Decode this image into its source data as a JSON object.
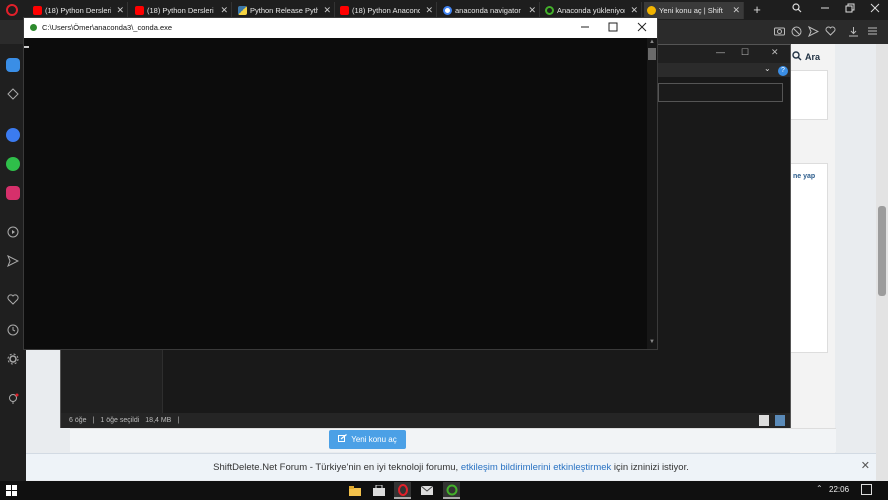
{
  "browser": {
    "tabs": [
      {
        "label": "(18) Python Dersleri",
        "icon": "youtube-icon"
      },
      {
        "label": "(18) Python Dersleri",
        "icon": "youtube-icon"
      },
      {
        "label": "Python Release Python",
        "icon": "python-icon"
      },
      {
        "label": "(18) Python Anaconda",
        "icon": "youtube-icon"
      },
      {
        "label": "anaconda navigator",
        "icon": "google-icon"
      },
      {
        "label": "Anaconda yükleniyor",
        "icon": "power-icon"
      },
      {
        "label": "Yeni konu aç | Shift",
        "icon": "shiftdelete-icon"
      }
    ],
    "close_glyph": "✕",
    "new_tab": "+",
    "search_label": "Ara"
  },
  "console": {
    "title": "C:\\Users\\Ömer\\anaconda3\\_conda.exe"
  },
  "explorer": {
    "status_items": "6 öğe",
    "status_selected": "1 öğe seçildi",
    "status_size": "18,4 MB"
  },
  "page": {
    "card_text": "ne yap",
    "new_topic_button": "Yeni konu aç",
    "notification": {
      "prefix": "ShiftDelete.Net Forum - Türkiye'nin en iyi teknoloji forumu,",
      "link": "etkileşim bildirimlerini etkinleştirmek",
      "suffix": "için izninizi istiyor."
    }
  },
  "taskbar": {
    "time": "22:06"
  },
  "colors": {
    "accent": "#4ba0e6",
    "opera_red": "#e0202a",
    "youtube_red": "#ff0000"
  }
}
